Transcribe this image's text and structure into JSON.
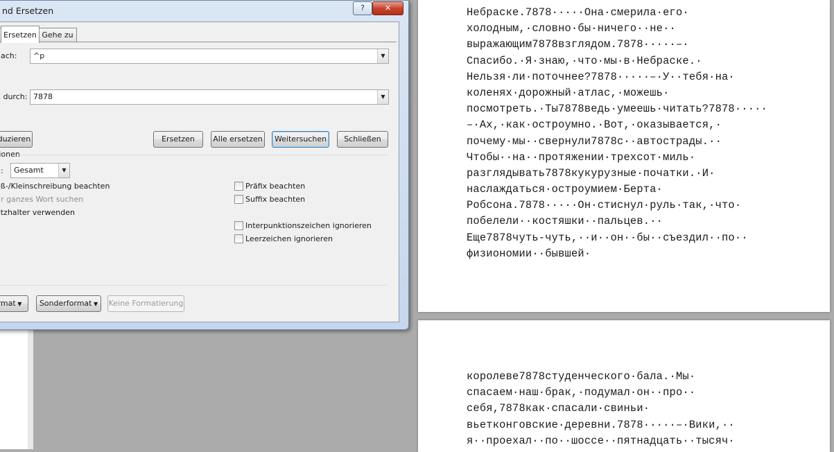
{
  "dialog": {
    "title": "nd Ersetzen",
    "help_label": "?",
    "close_label": "✕",
    "tabs": [
      {
        "label": ""
      },
      {
        "label": "Ersetzen"
      },
      {
        "label": "Gehe zu"
      }
    ],
    "find_label": "nach:",
    "find_value": "^p",
    "replace_label": "n durch:",
    "replace_value": "7878",
    "reduce_label": "eduzieren",
    "replace_btn": "Ersetzen",
    "replace_all_btn": "Alle ersetzen",
    "find_next_btn": "Weitersuchen",
    "close_btn": "Schließen",
    "options_header": "tionen",
    "search_label": "n:",
    "search_value": "Gesamt",
    "options_left": [
      {
        "label": "oß-/Kleinschreibung beachten",
        "enabled": true
      },
      {
        "label": "ur ganzes Wort suchen",
        "enabled": false
      },
      {
        "label": "atzhalter verwenden",
        "enabled": true
      }
    ],
    "options_right": [
      {
        "label": "Präfix beachten"
      },
      {
        "label": "Suffix beachten"
      },
      {
        "label": "Interpunktionszeichen ignorieren"
      },
      {
        "label": "Leerzeichen ignorieren"
      }
    ],
    "format_btn": "rmat",
    "special_btn": "Sonderformat",
    "no_format_btn": "Keine Formatierung"
  },
  "document": {
    "page1_lines": [
      "Небраске.7878·····Она·смерила·его·",
      "холодным,·словно·бы·ничего··не··",
      "выражающим7878взглядом.7878·····–·",
      "Спасибо.·Я·знаю,·что·мы·в·Небраске.·",
      "Нельзя·ли·поточнее?7878·····–·У··тебя·на·",
      "коленях·дорожный·атлас,·можешь·",
      "посмотреть.·Ты7878ведь·умеешь·читать?7878·····",
      "–·Ах,·как·остроумно.·Вот,·оказывается,·",
      "почему·мы··свернули7878с··автострады.··",
      "Чтобы··на··протяжении·трехсот·миль·",
      "разглядывать7878кукурузные·початки.·И·",
      "наслаждаться·остроумием·Берта·",
      "Робсона.7878·····Он·стиснул·руль·так,·что·",
      "побелели··костяшки··пальцев.··",
      "Еще7878чуть-чуть,··и··он··бы··съездил··по··",
      "физиономии··бывшей·"
    ],
    "page2_lines": [
      "королеве7878студенческого·бала.·Мы·",
      "спасаем·наш·брак,·подумал·он··про··",
      "себя,7878как·спасали·свиньи·",
      "вьетконговские·деревни.7878·····–·Вики,··",
      "я··проехал··по··шоссе··пятнадцать··тысяч·"
    ]
  },
  "colors": {
    "background": "#ababab",
    "dialog_frame": "#c6d6ec",
    "close_red": "#c7442d",
    "spell_error": "#e02020",
    "grammar_error": "#2e9e2e"
  }
}
